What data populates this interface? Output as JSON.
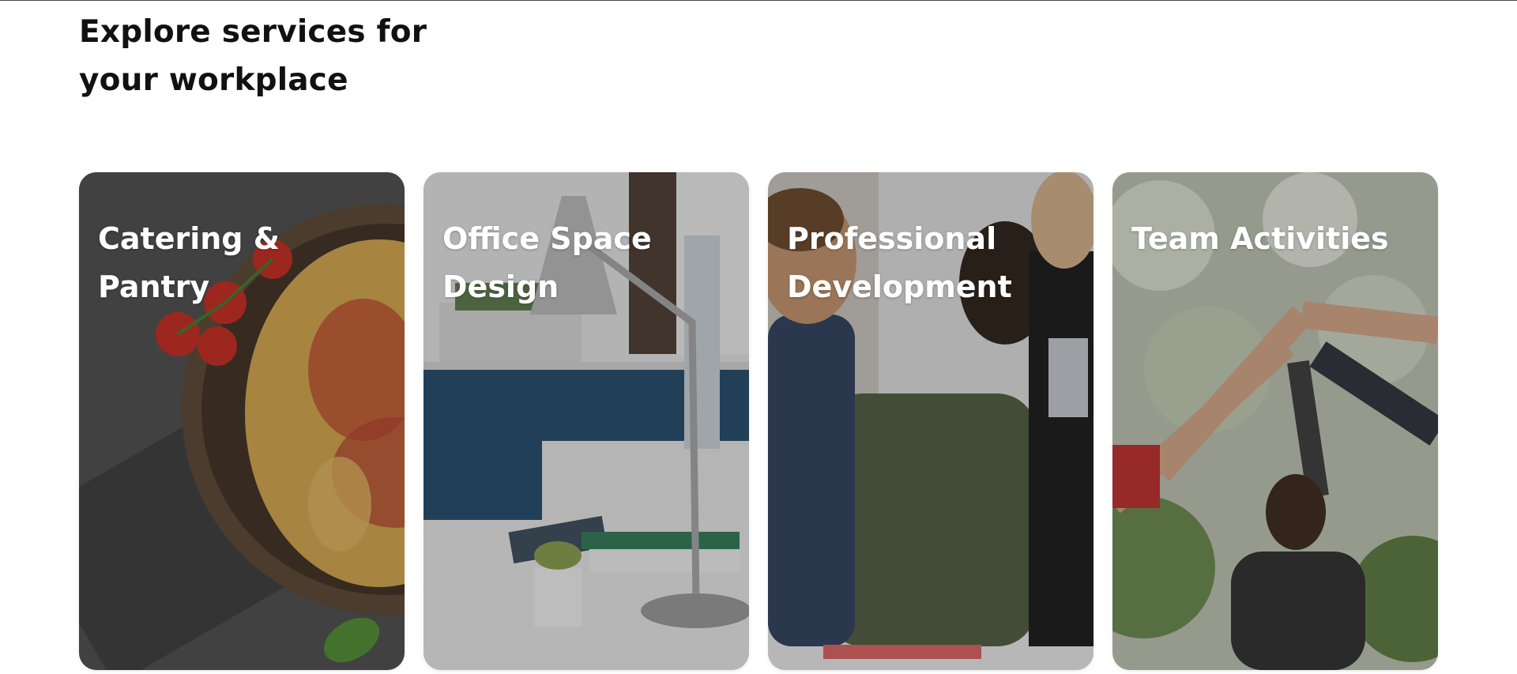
{
  "section": {
    "title": "Explore services for your workplace"
  },
  "cards": [
    {
      "title": "Catering & Pantry",
      "image_icon": "pasta-dish-photo"
    },
    {
      "title": "Office Space Design",
      "image_icon": "desk-lamp-office-photo"
    },
    {
      "title": "Professional Development",
      "image_icon": "team-meeting-photo"
    },
    {
      "title": "Team Activities",
      "image_icon": "high-five-photo"
    }
  ],
  "colors": {
    "title_text": "#111111",
    "card_text": "#ffffff",
    "background": "#ffffff"
  }
}
